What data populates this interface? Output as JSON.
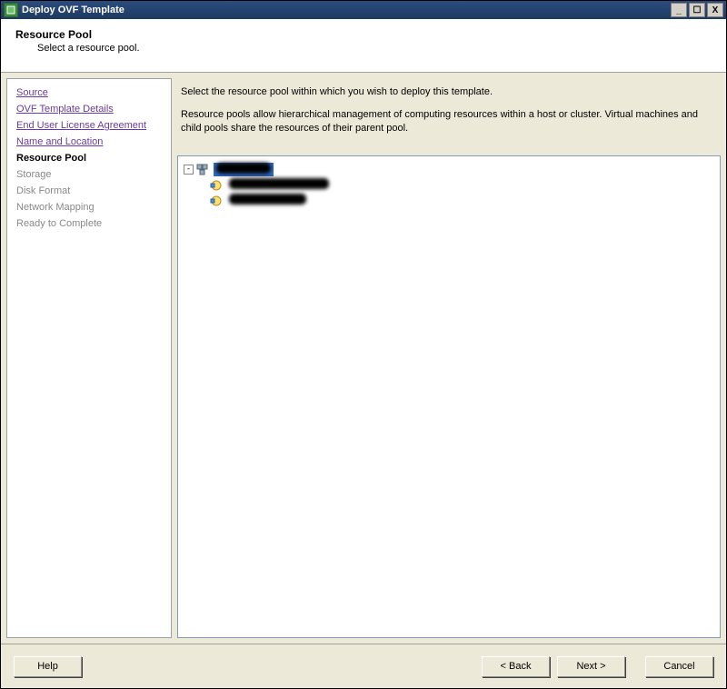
{
  "window": {
    "title": "Deploy OVF Template",
    "min_label": "_",
    "max_label": "☐",
    "close_label": "X"
  },
  "header": {
    "title": "Resource Pool",
    "subtitle": "Select a resource pool."
  },
  "sidebar": {
    "steps": [
      {
        "label": "Source",
        "state": "link"
      },
      {
        "label": "OVF Template Details",
        "state": "link"
      },
      {
        "label": "End User License Agreement",
        "state": "link"
      },
      {
        "label": "Name and Location",
        "state": "link"
      },
      {
        "label": "Resource Pool",
        "state": "current"
      },
      {
        "label": "Storage",
        "state": "disabled"
      },
      {
        "label": "Disk Format",
        "state": "disabled"
      },
      {
        "label": "Network Mapping",
        "state": "disabled"
      },
      {
        "label": "Ready to Complete",
        "state": "disabled"
      }
    ]
  },
  "main": {
    "intro": "Select the resource pool within which you wish to deploy this template.",
    "description": "Resource pools allow hierarchical management of computing resources within a host or cluster. Virtual machines and child pools share the resources of their parent pool.",
    "tree": {
      "root": {
        "expander": "-",
        "label": "████████",
        "selected": true
      },
      "children": [
        {
          "label": "██████████████"
        },
        {
          "label": "██████████"
        }
      ]
    }
  },
  "footer": {
    "help": "Help",
    "back": "< Back",
    "next": "Next >",
    "cancel": "Cancel"
  }
}
